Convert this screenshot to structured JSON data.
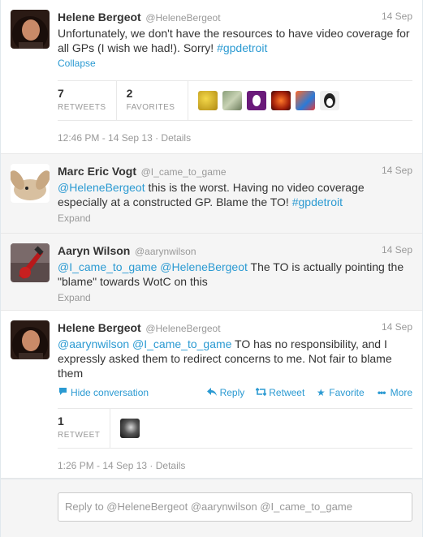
{
  "tweets": [
    {
      "name": "Helene Bergeot",
      "handle": "@HeleneBergeot",
      "time": "14 Sep",
      "text_plain": "Unfortunately, we don't have the resources to have video coverage for all GPs (I wish we had!). Sorry! ",
      "text_link": "#gpdetroit",
      "action": "Collapse",
      "retweets": "7",
      "retweets_label": "RETWEETS",
      "favorites": "2",
      "favorites_label": "FAVORITES",
      "meta": "12:46 PM - 14 Sep 13 · Details"
    },
    {
      "name": "Marc Eric Vogt",
      "handle": "@I_came_to_game",
      "time": "14 Sep",
      "mention": "@HeleneBergeot",
      "text_plain": "  this is the worst. Having no video coverage especially at a constructed GP. Blame the TO! ",
      "text_link": "#gpdetroit",
      "action": "Expand"
    },
    {
      "name": "Aaryn Wilson",
      "handle": "@aarynwilson",
      "time": "14 Sep",
      "mention1": "@I_came_to_game",
      "mention2": "@HeleneBergeot",
      "text_plain": " The TO is actually pointing the \"blame\" towards WotC on this",
      "action": "Expand"
    },
    {
      "name": "Helene Bergeot",
      "handle": "@HeleneBergeot",
      "time": "14 Sep",
      "mention1": "@aarynwilson",
      "mention2": "@I_came_to_game",
      "text_plain": " TO has no responsibility, and I expressly asked them to redirect concerns to me. Not fair to blame them",
      "hide": "Hide conversation",
      "reply": "Reply",
      "retweet": "Retweet",
      "favorite": "Favorite",
      "more": "More",
      "retweets": "1",
      "retweets_label": "RETWEET",
      "meta": "1:26 PM - 14 Sep 13 · Details"
    }
  ],
  "reply_box": {
    "placeholder": "Reply to @HeleneBergeot @aarynwilson @I_came_to_game"
  },
  "colors": {
    "link": "#2b9ad2",
    "muted": "#999999",
    "panel": "#f5f5f5"
  },
  "icons": [
    "speech-bubble-icon",
    "reply-arrow-icon",
    "retweet-icon",
    "star-icon",
    "more-dots-icon"
  ]
}
